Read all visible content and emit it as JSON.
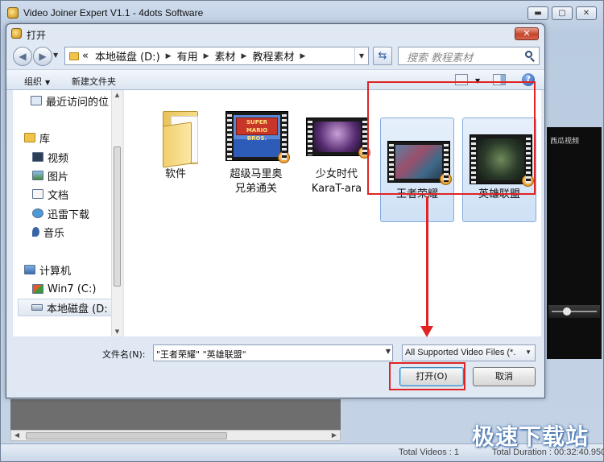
{
  "app": {
    "title": "Video Joiner Expert V1.1 - 4dots Software",
    "buttons": {
      "minimize": "▬",
      "maximize": "▢",
      "close": "✕"
    },
    "video_overlay_text": "西瓜视频",
    "status": {
      "total_videos": "Total Videos : 1",
      "total_duration": "Total Duration : 00:32:40.950"
    },
    "watermark": "极速下载站"
  },
  "dialog": {
    "title": "打开",
    "close_label": "✕",
    "breadcrumb": [
      "«",
      "本地磁盘 (D:)",
      "有用",
      "素材",
      "教程素材"
    ],
    "search_placeholder": "搜索 教程素材",
    "toolbar": {
      "organize": "组织",
      "new_folder": "新建文件夹",
      "help": "?"
    },
    "nav_items": [
      {
        "label": "最近访问的位",
        "icon": "recent-places-icon"
      },
      {
        "label": "库",
        "icon": "library-icon"
      },
      {
        "label": "视频",
        "icon": "video-library-icon"
      },
      {
        "label": "图片",
        "icon": "picture-library-icon"
      },
      {
        "label": "文档",
        "icon": "document-library-icon"
      },
      {
        "label": "迅雷下载",
        "icon": "thunder-download-icon"
      },
      {
        "label": "音乐",
        "icon": "music-note-icon"
      },
      {
        "label": "计算机",
        "icon": "computer-icon"
      },
      {
        "label": "Win7 (C:)",
        "icon": "windows-drive-icon"
      },
      {
        "label": "本地磁盘 (D:",
        "icon": "local-drive-icon",
        "selected": true
      }
    ],
    "files": [
      {
        "label": "软件",
        "type": "folder",
        "selected": false
      },
      {
        "label": "超级马里奥\n兄弟通关",
        "type": "video",
        "thumb_text": "SUPER MARIO BROS.",
        "selected": false
      },
      {
        "label": "少女时代\nKaraT-ara",
        "type": "video",
        "selected": false
      },
      {
        "label": "王者荣耀",
        "type": "video",
        "selected": true
      },
      {
        "label": "英雄联盟",
        "type": "video",
        "selected": true
      }
    ],
    "filename_label": "文件名(N):",
    "filename_value": "\"王者荣耀\" \"英雄联盟\"",
    "filetype_value": "All Supported Video Files (*.",
    "open_button": "打开(O)",
    "cancel_button": "取消"
  },
  "colors": {
    "highlight_red": "#e02424",
    "selection_blue": "#cfe1f6"
  }
}
